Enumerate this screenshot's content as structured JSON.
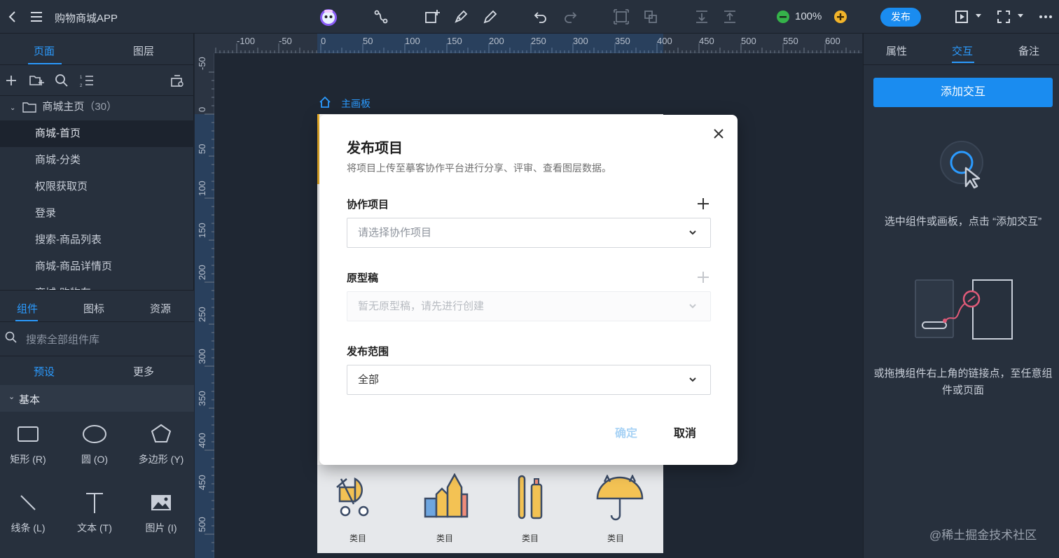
{
  "topbar": {
    "title": "购物商城APP",
    "zoom": "100%",
    "publish_label": "发布"
  },
  "left": {
    "tabs": [
      "页面",
      "图层"
    ],
    "folder": {
      "name": "商城主页",
      "count": "（30）"
    },
    "pages": [
      "商城-首页",
      "商城-分类",
      "权限获取页",
      "登录",
      "搜索-商品列表",
      "商城-商品详情页",
      "商城-购物车"
    ],
    "lib_tabs": [
      "组件",
      "图标",
      "资源"
    ],
    "search_placeholder": "搜索全部组件库",
    "sub_tabs": [
      "预设",
      "更多"
    ],
    "section": "基本",
    "components": [
      {
        "label": "矩形 (R)",
        "icon": "rectangle-icon"
      },
      {
        "label": "圆 (O)",
        "icon": "circle-icon"
      },
      {
        "label": "多边形 (Y)",
        "icon": "polygon-icon"
      },
      {
        "label": "线条 (L)",
        "icon": "line-icon"
      },
      {
        "label": "文本 (T)",
        "icon": "text-icon"
      },
      {
        "label": "图片 (I)",
        "icon": "image-icon"
      }
    ]
  },
  "canvas": {
    "ruler_h": [
      "-100",
      "-50",
      "0",
      "50",
      "100",
      "150",
      "200",
      "250",
      "300",
      "350",
      "400",
      "450",
      "500",
      "550",
      "600"
    ],
    "ruler_v": [
      "-50",
      "0",
      "50",
      "100",
      "150",
      "200",
      "250",
      "300",
      "350",
      "400",
      "450",
      "500"
    ],
    "artboard_label": "主画板",
    "categories": [
      "类目",
      "类目",
      "类目",
      "类目"
    ]
  },
  "dialog": {
    "title": "发布项目",
    "description": "将项目上传至摹客协作平台进行分享、评审、查看图层数据。",
    "fields": [
      {
        "label": "协作项目",
        "value": "请选择协作项目"
      },
      {
        "label": "原型稿",
        "value": "暂无原型稿，请先进行创建"
      },
      {
        "label": "发布范围",
        "value": "全部"
      }
    ],
    "confirm": "确定",
    "cancel": "取消"
  },
  "right": {
    "tabs": [
      "属性",
      "交互",
      "备注"
    ],
    "add_button": "添加交互",
    "hint1": "选中组件或画板，点击 “添加交互”",
    "hint2": "或拖拽组件右上角的链接点，至任意组件或页面"
  },
  "watermark": "@稀土掘金技术社区",
  "colors": {
    "accent": "#1a8cf0",
    "panel": "#27303d",
    "canvas": "#1f2733"
  }
}
